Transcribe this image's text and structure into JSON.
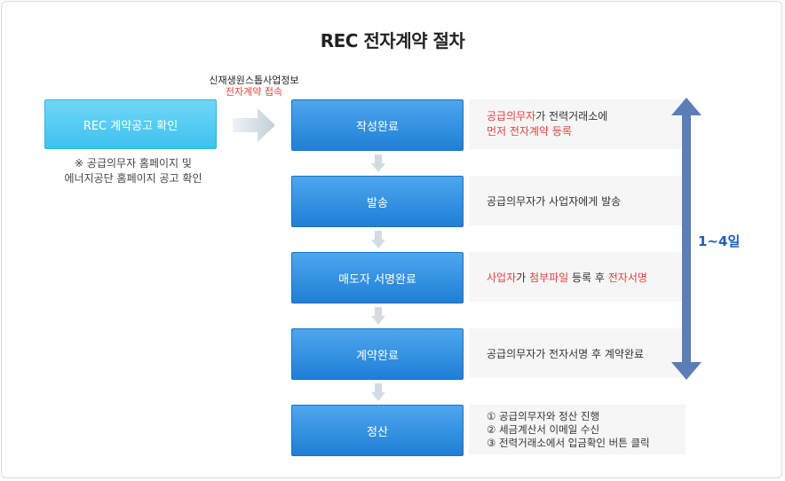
{
  "title": "REC 전자계약 절차",
  "start": {
    "label": "REC 계약공고 확인",
    "note_line1": "※ 공급의무자 홈페이지 및",
    "note_line2": "에너지공단 홈페이지 공고 확인"
  },
  "site": {
    "line1": "신재생원스톱사업정보",
    "line2": "전자계약 접속"
  },
  "steps": [
    {
      "label": "작성완료"
    },
    {
      "label": "발송"
    },
    {
      "label": "매도자 서명완료"
    },
    {
      "label": "계약완료"
    },
    {
      "label": "정산"
    }
  ],
  "descriptions": {
    "d1_a_red": "공급의무자",
    "d1_a_rest": "가 전력거래소에",
    "d1_b_red": "먼저 전자계약 등록",
    "d2": "공급의무자가 사업자에게 발송",
    "d3_p1": "사업자",
    "d3_p2": "가 ",
    "d3_p3": "첨부파일",
    "d3_p4": " 등록 후 ",
    "d3_p5": "전자서명",
    "d4": "공급의무자가 전자서명 후 계약완료",
    "d5": [
      "① 공급의무자와 정산 진행",
      "② 세금계산서 이메일 수신",
      "③ 전력거래소에서 입금확인 버튼 클릭"
    ]
  },
  "duration": "1~4일",
  "colors": {
    "step_blue": "#2a8ae0",
    "start_cyan": "#4cc7f0",
    "highlight_red": "#e8403f",
    "duration_blue": "#1f5eb8",
    "bar_blue": "#5b7db8"
  }
}
